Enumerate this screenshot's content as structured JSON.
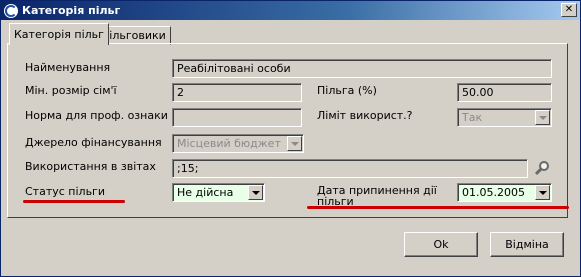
{
  "window": {
    "title": "Категорія пільг",
    "close_glyph": "✕"
  },
  "tabs": [
    {
      "label": "Категорія пільг",
      "active": true
    },
    {
      "label": "Пільговики",
      "active": false
    }
  ],
  "form": {
    "name_label": "Найменування",
    "name_value": "Реабілітовані особи",
    "min_family_label": "Мін. розмір сім'ї",
    "min_family_value": "2",
    "benefit_pct_label": "Пільга (%)",
    "benefit_pct_value": "50.00",
    "norm_label": "Норма для проф. ознаки",
    "norm_value": "",
    "usage_limit_label": "Ліміт використ.?",
    "usage_limit_value": "Так",
    "funding_label": "Джерело фінансування",
    "funding_value": "Місцевий бюджет",
    "reports_label": "Використання в звітах",
    "reports_value": ";15;",
    "status_label": "Статус пільги",
    "status_value": "Не дійсна",
    "stop_date_label": "Дата припинення дії пільги",
    "stop_date_value": "01.05.2005"
  },
  "buttons": {
    "ok_label": "Ok",
    "cancel_label": "Відміна"
  },
  "colors": {
    "accent_underline": "#cc0000",
    "titlebar": "#0a246a",
    "active_field": "#e8ffe8"
  }
}
